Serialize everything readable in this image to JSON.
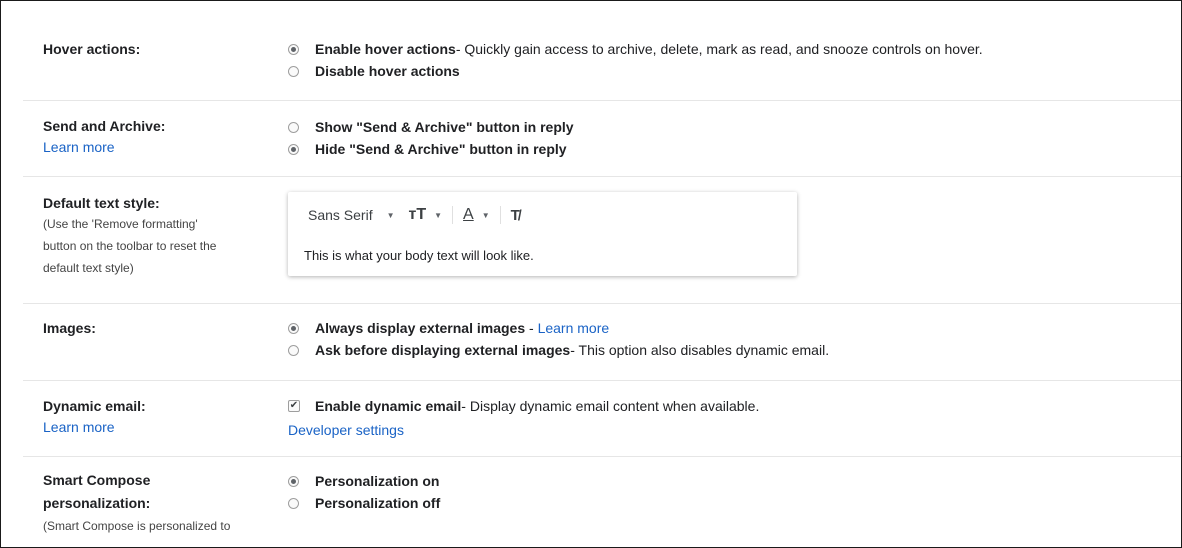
{
  "hover": {
    "title": "Hover actions:",
    "options": [
      {
        "label": "Enable hover actions",
        "desc": " - Quickly gain access to archive, delete, mark as read, and snooze controls on hover.",
        "selected": true
      },
      {
        "label": "Disable hover actions",
        "desc": "",
        "selected": false
      }
    ]
  },
  "send_archive": {
    "title": "Send and Archive:",
    "learn_more": "Learn more",
    "options": [
      {
        "label": "Show \"Send & Archive\" button in reply",
        "selected": false
      },
      {
        "label": "Hide \"Send & Archive\" button in reply",
        "selected": true
      }
    ]
  },
  "text_style": {
    "title": "Default text style:",
    "sub": [
      "(Use the 'Remove formatting'",
      "button on the toolbar to reset the",
      "default text style)"
    ],
    "font": "Sans Serif",
    "size_icon": "text-size-icon",
    "color_icon": "text-color-icon",
    "remove_icon": "remove-formatting-icon",
    "color_glyph": "A",
    "size_glyph": "тТ",
    "remove_glyph": "T̸",
    "caret": "▼",
    "sample": "This is what your body text will look like."
  },
  "images": {
    "title": "Images:",
    "options": [
      {
        "label": "Always display external images",
        "sep": " - ",
        "link": "Learn more",
        "desc": "",
        "selected": true
      },
      {
        "label": "Ask before displaying external images",
        "sep": "",
        "link": "",
        "desc": " - This option also disables dynamic email.",
        "selected": false
      }
    ]
  },
  "dynamic": {
    "title": "Dynamic email:",
    "learn_more": "Learn more",
    "check_label": "Enable dynamic email",
    "check_desc": " - Display dynamic email content when available.",
    "checked": true,
    "dev_link": "Developer settings"
  },
  "smart": {
    "title_1": "Smart Compose",
    "title_2": "personalization:",
    "sub": "(Smart Compose is personalized to",
    "options": [
      {
        "label": "Personalization on",
        "selected": true
      },
      {
        "label": "Personalization off",
        "selected": false
      }
    ]
  },
  "colors": {
    "link": "#1a63c6",
    "divider": "#e6e6e6"
  }
}
